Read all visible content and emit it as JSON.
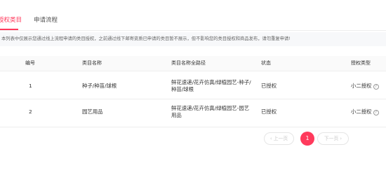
{
  "tabs": [
    {
      "label": "授权类目",
      "active": true
    },
    {
      "label": "申请流程",
      "active": false
    }
  ],
  "notice": "本列表中仅展示您通过线上流程申请的类目授权，之前通过线下邮寄资质已申请的类目暂不展示，但不影响您的类目授权和商品发布，请勿重复申请!",
  "table": {
    "headers": [
      "编号",
      "类目名称",
      "类目名称全路径",
      "状态",
      "授权类型"
    ],
    "rows": [
      {
        "id": "1",
        "name": "种子/种苗/球根",
        "path": "鲜花速递/花卉仿真/绿植园艺-种子/种苗/球根",
        "status": "已授权",
        "auth_type": "小二授权"
      },
      {
        "id": "2",
        "name": "园艺用品",
        "path": "鲜花速递/花卉仿真/绿植园艺-园艺用品",
        "status": "已授权",
        "auth_type": "小二授权"
      }
    ]
  },
  "pagination": {
    "prev_label": "‹ 上一页",
    "current_page": "1",
    "next_label": "下一页 ›"
  },
  "colors": {
    "accent": "#ff3a5c"
  },
  "icons": {
    "help": "question-circle-icon"
  }
}
